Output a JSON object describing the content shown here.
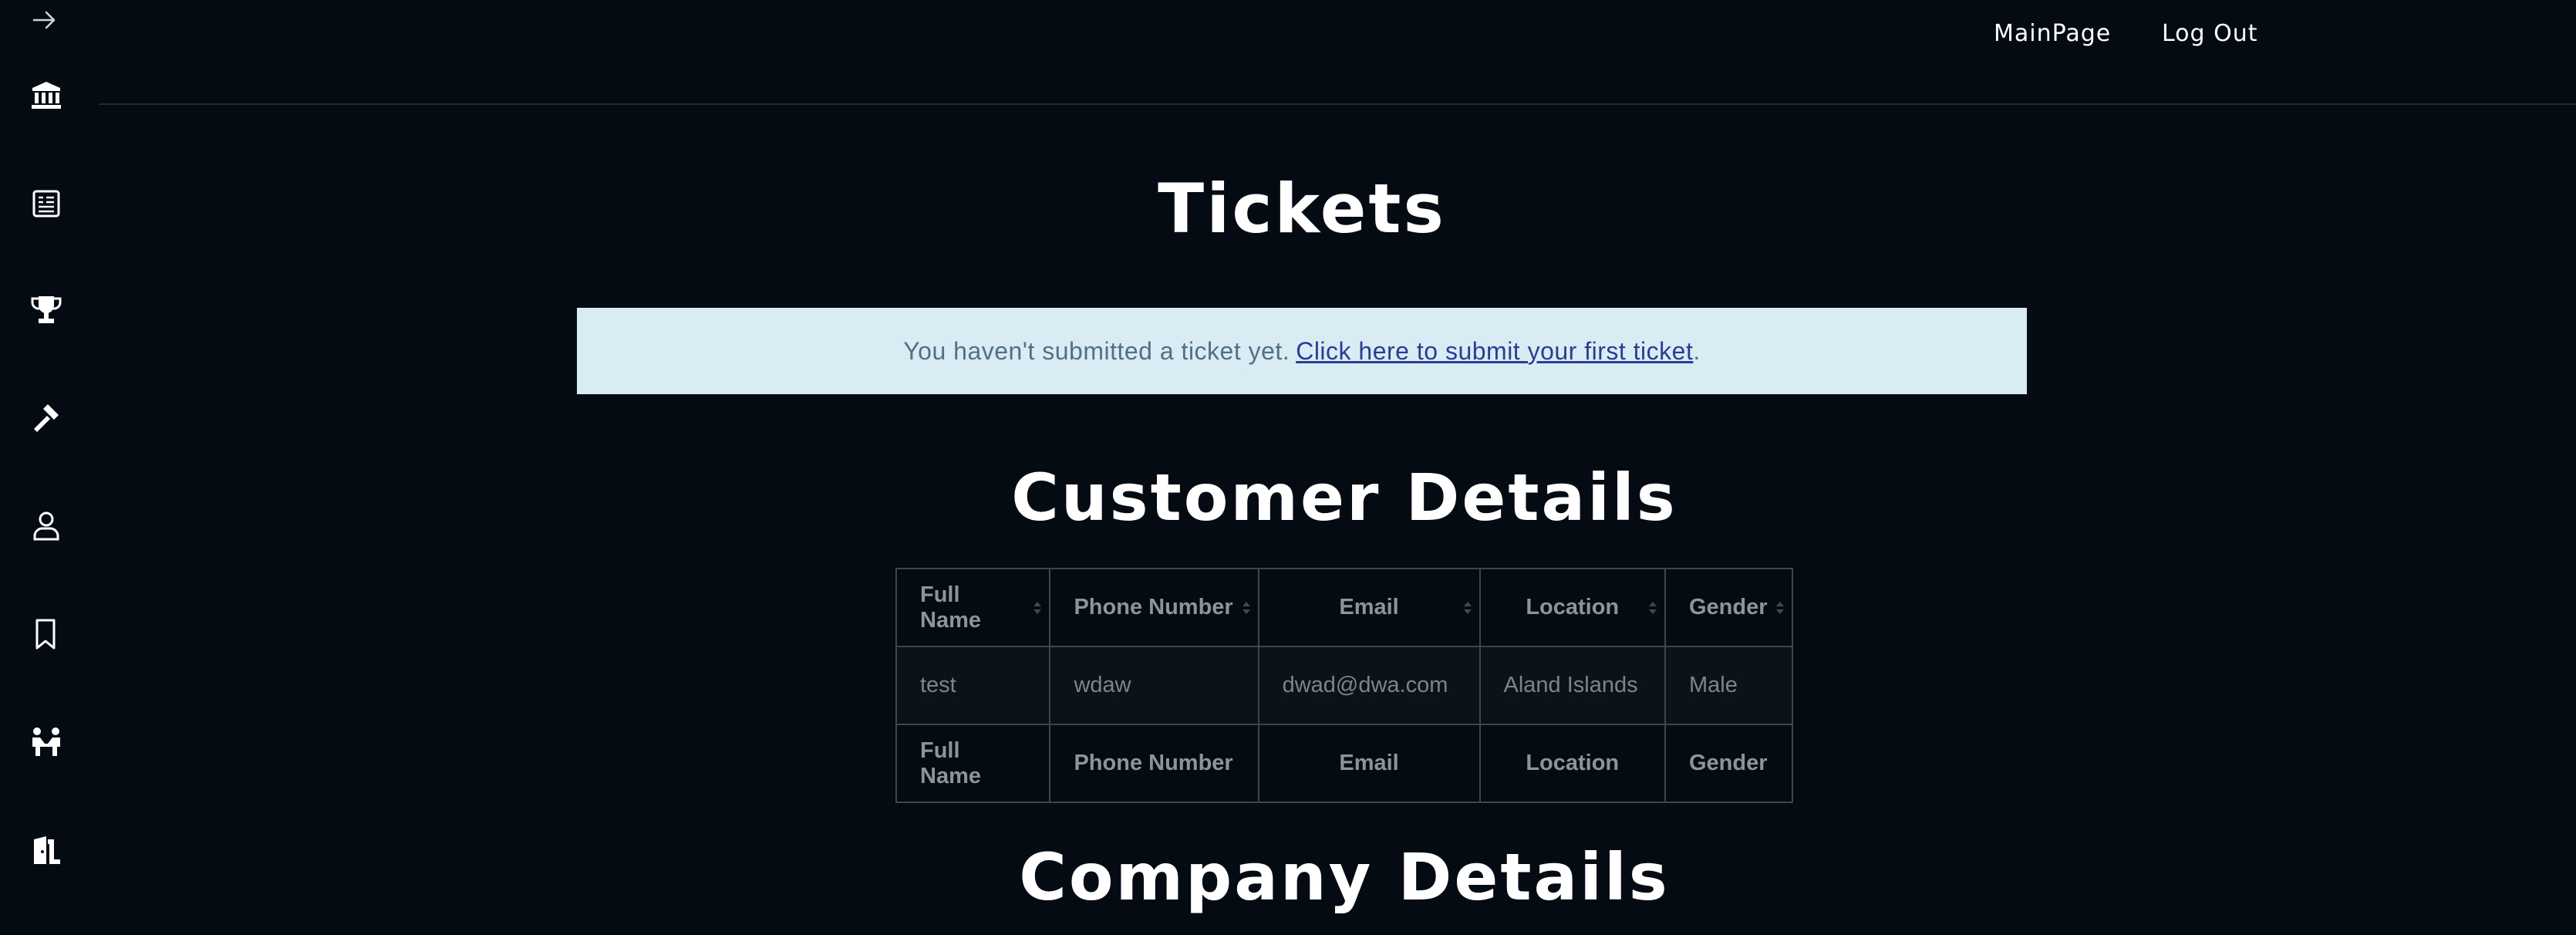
{
  "nav": {
    "main_page": "MainPage",
    "log_out": "Log Out"
  },
  "sidebar": {
    "icons": [
      "arrow-right-icon",
      "bank-icon",
      "news-icon",
      "trophy-icon",
      "gavel-icon",
      "user-icon",
      "bookmark-icon",
      "handshake-icon",
      "door-exit-icon"
    ]
  },
  "page": {
    "title": "Tickets"
  },
  "alert": {
    "text": "You haven't submitted a ticket yet.",
    "link_text": "Click here to submit your first ticket",
    "trailing": "."
  },
  "customer": {
    "title": "Customer Details",
    "columns": [
      "Full Name",
      "Phone Number",
      "Email",
      "Location",
      "Gender"
    ],
    "rows": [
      [
        "test",
        "wdaw",
        "dwad@dwa.com",
        "Aland Islands",
        "Male"
      ]
    ],
    "footer": [
      "Full Name",
      "Phone Number",
      "Email",
      "Location",
      "Gender"
    ]
  },
  "company": {
    "title": "Company Details"
  },
  "colors": {
    "background": "#040b12",
    "alert_bg": "#d9ecf3",
    "alert_link": "#2a3d94",
    "table_border": "#3b4750"
  }
}
